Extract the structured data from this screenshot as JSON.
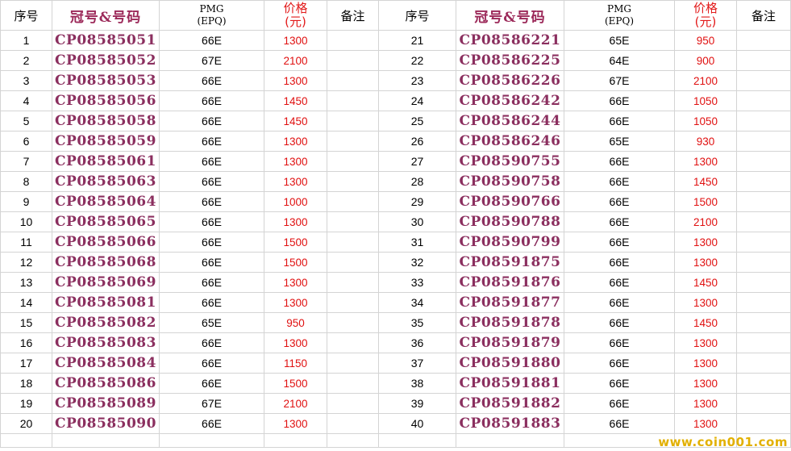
{
  "headers": {
    "seq": "序号",
    "serial": "冠号&号码",
    "grade_line1": "PMG",
    "grade_line2": "(EPQ)",
    "price_line1": "价格",
    "price_line2": "(元)",
    "note": "备注"
  },
  "left_rows": [
    {
      "seq": "1",
      "serial": "CP08585051",
      "grade": "66E",
      "price": "1300"
    },
    {
      "seq": "2",
      "serial": "CP08585052",
      "grade": "67E",
      "price": "2100"
    },
    {
      "seq": "3",
      "serial": "CP08585053",
      "grade": "66E",
      "price": "1300"
    },
    {
      "seq": "4",
      "serial": "CP08585056",
      "grade": "66E",
      "price": "1450"
    },
    {
      "seq": "5",
      "serial": "CP08585058",
      "grade": "66E",
      "price": "1450"
    },
    {
      "seq": "6",
      "serial": "CP08585059",
      "grade": "66E",
      "price": "1300"
    },
    {
      "seq": "7",
      "serial": "CP08585061",
      "grade": "66E",
      "price": "1300"
    },
    {
      "seq": "8",
      "serial": "CP08585063",
      "grade": "66E",
      "price": "1300"
    },
    {
      "seq": "9",
      "serial": "CP08585064",
      "grade": "66E",
      "price": "1000"
    },
    {
      "seq": "10",
      "serial": "CP08585065",
      "grade": "66E",
      "price": "1300"
    },
    {
      "seq": "11",
      "serial": "CP08585066",
      "grade": "66E",
      "price": "1500"
    },
    {
      "seq": "12",
      "serial": "CP08585068",
      "grade": "66E",
      "price": "1500"
    },
    {
      "seq": "13",
      "serial": "CP08585069",
      "grade": "66E",
      "price": "1300"
    },
    {
      "seq": "14",
      "serial": "CP08585081",
      "grade": "66E",
      "price": "1300"
    },
    {
      "seq": "15",
      "serial": "CP08585082",
      "grade": "65E",
      "price": "950"
    },
    {
      "seq": "16",
      "serial": "CP08585083",
      "grade": "66E",
      "price": "1300"
    },
    {
      "seq": "17",
      "serial": "CP08585084",
      "grade": "66E",
      "price": "1150"
    },
    {
      "seq": "18",
      "serial": "CP08585086",
      "grade": "66E",
      "price": "1500"
    },
    {
      "seq": "19",
      "serial": "CP08585089",
      "grade": "67E",
      "price": "2100"
    },
    {
      "seq": "20",
      "serial": "CP08585090",
      "grade": "66E",
      "price": "1300"
    }
  ],
  "right_rows": [
    {
      "seq": "21",
      "serial": "CP08586221",
      "grade": "65E",
      "price": "950"
    },
    {
      "seq": "22",
      "serial": "CP08586225",
      "grade": "64E",
      "price": "900"
    },
    {
      "seq": "23",
      "serial": "CP08586226",
      "grade": "67E",
      "price": "2100"
    },
    {
      "seq": "24",
      "serial": "CP08586242",
      "grade": "66E",
      "price": "1050"
    },
    {
      "seq": "25",
      "serial": "CP08586244",
      "grade": "66E",
      "price": "1050"
    },
    {
      "seq": "26",
      "serial": "CP08586246",
      "grade": "65E",
      "price": "930"
    },
    {
      "seq": "27",
      "serial": "CP08590755",
      "grade": "66E",
      "price": "1300"
    },
    {
      "seq": "28",
      "serial": "CP08590758",
      "grade": "66E",
      "price": "1450"
    },
    {
      "seq": "29",
      "serial": "CP08590766",
      "grade": "66E",
      "price": "1500"
    },
    {
      "seq": "30",
      "serial": "CP08590788",
      "grade": "66E",
      "price": "2100"
    },
    {
      "seq": "31",
      "serial": "CP08590799",
      "grade": "66E",
      "price": "1300"
    },
    {
      "seq": "32",
      "serial": "CP08591875",
      "grade": "66E",
      "price": "1300"
    },
    {
      "seq": "33",
      "serial": "CP08591876",
      "grade": "66E",
      "price": "1450"
    },
    {
      "seq": "34",
      "serial": "CP08591877",
      "grade": "66E",
      "price": "1300"
    },
    {
      "seq": "35",
      "serial": "CP08591878",
      "grade": "66E",
      "price": "1450"
    },
    {
      "seq": "36",
      "serial": "CP08591879",
      "grade": "66E",
      "price": "1300"
    },
    {
      "seq": "37",
      "serial": "CP08591880",
      "grade": "66E",
      "price": "1300"
    },
    {
      "seq": "38",
      "serial": "CP08591881",
      "grade": "66E",
      "price": "1300"
    },
    {
      "seq": "39",
      "serial": "CP08591882",
      "grade": "66E",
      "price": "1300"
    },
    {
      "seq": "40",
      "serial": "CP08591883",
      "grade": "66E",
      "price": "1300"
    }
  ],
  "watermark": "www.coin001.com",
  "colors": {
    "serial": "#8b2f5f",
    "price": "#e01010",
    "grid": "#d4d4d4",
    "watermark": "#e2b000"
  }
}
